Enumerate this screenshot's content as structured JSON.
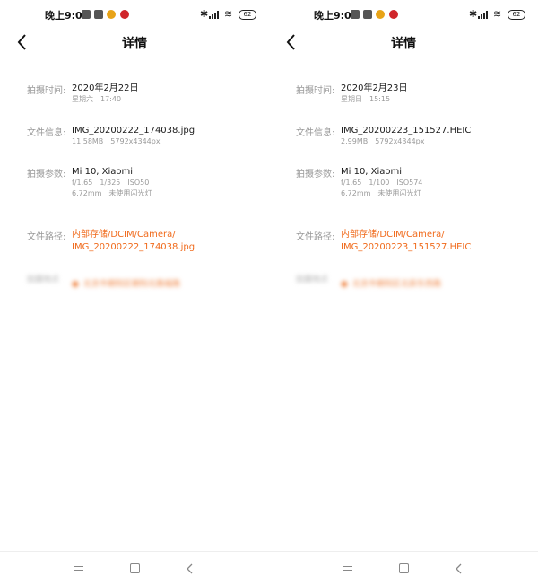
{
  "panels": [
    {
      "status": {
        "time": "晚上9:01",
        "battery": "62"
      },
      "title": "详情",
      "capture_time": {
        "label": "拍摄时间:",
        "date": "2020年2月22日",
        "weekday": "星期六",
        "time": "17:40"
      },
      "file_info": {
        "label": "文件信息:",
        "name": "IMG_20200222_174038.jpg",
        "size": "11.58MB",
        "resolution": "5792x4344px"
      },
      "params": {
        "label": "拍摄参数:",
        "device": "Mi 10, Xiaomi",
        "aperture": "f/1.65",
        "shutter": "1/325",
        "iso": "ISO50",
        "focal": "6.72mm",
        "flash": "未使用闪光灯"
      },
      "file_path": {
        "label": "文件路径:",
        "line1": "内部存储/DCIM/Camera/",
        "line2": "IMG_20200222_174038.jpg"
      },
      "location": {
        "label": "拍摄地点",
        "value": "北京市朝阳区朝阳北路福路"
      }
    },
    {
      "status": {
        "time": "晚上9:01",
        "battery": "62"
      },
      "title": "详情",
      "capture_time": {
        "label": "拍摄时间:",
        "date": "2020年2月23日",
        "weekday": "星期日",
        "time": "15:15"
      },
      "file_info": {
        "label": "文件信息:",
        "name": "IMG_20200223_151527.HEIC",
        "size": "2.99MB",
        "resolution": "5792x4344px"
      },
      "params": {
        "label": "拍摄参数:",
        "device": "Mi 10, Xiaomi",
        "aperture": "f/1.65",
        "shutter": "1/100",
        "iso": "ISO574",
        "focal": "6.72mm",
        "flash": "未使用闪光灯"
      },
      "file_path": {
        "label": "文件路径:",
        "line1": "内部存储/DCIM/Camera/",
        "line2": "IMG_20200223_151527.HEIC"
      },
      "location": {
        "label": "拍摄地点",
        "value": "北京市朝阳区北辰东西路"
      }
    }
  ],
  "icons": {
    "back": "chevron-left-icon",
    "nav_menu": "menu-icon",
    "nav_home": "home-square-icon",
    "nav_back": "back-chevron-icon",
    "location": "location-pin-icon"
  },
  "colors": {
    "accent": "#f06a1b",
    "label": "#9a9a9a",
    "text": "#1a1a1a"
  }
}
